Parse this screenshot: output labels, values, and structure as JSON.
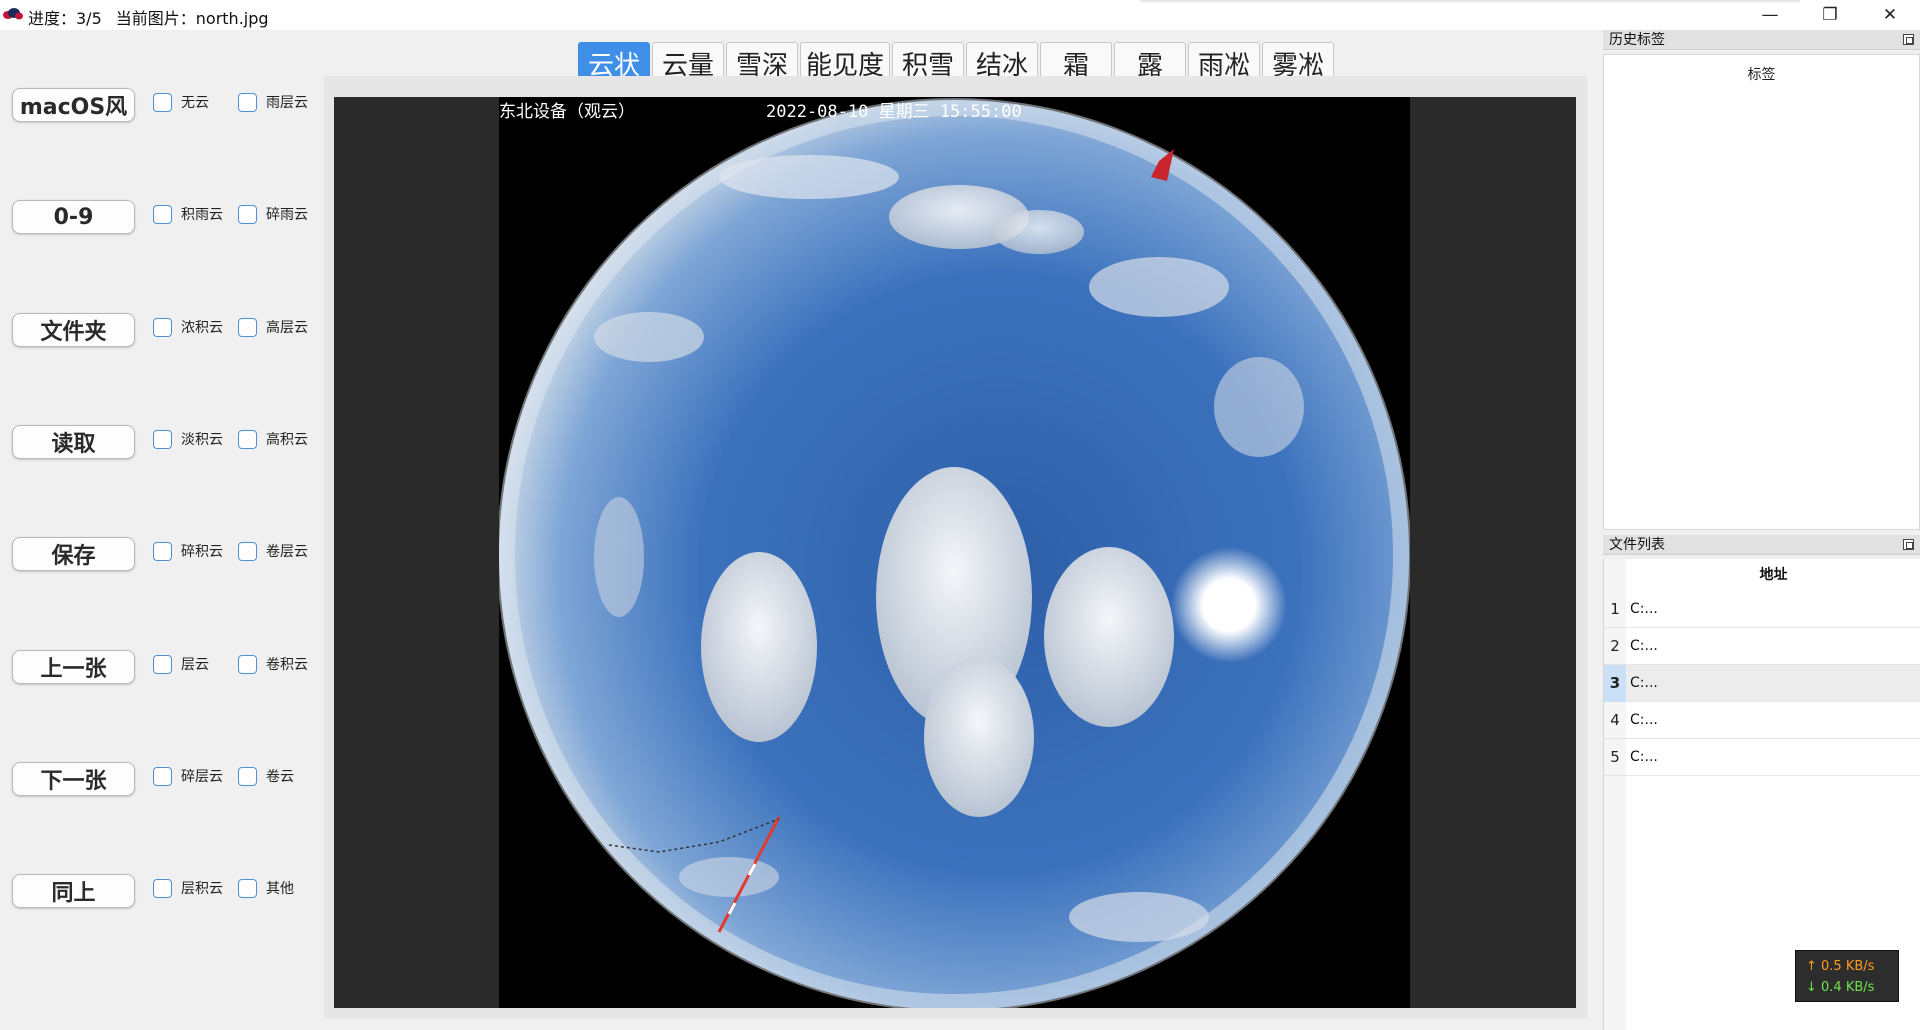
{
  "titlebar": {
    "progress_label": "进度：3/5",
    "current_image_label": "当前图片：north.jpg",
    "minimize_glyph": "—",
    "maximize_glyph": "❐",
    "close_glyph": "✕"
  },
  "sidebar": {
    "rows": [
      {
        "button": "macOS风",
        "check1": "无云",
        "check2": "雨层云"
      },
      {
        "button": "0-9",
        "check1": "积雨云",
        "check2": "碎雨云"
      },
      {
        "button": "文件夹",
        "check1": "浓积云",
        "check2": "高层云"
      },
      {
        "button": "读取",
        "check1": "淡积云",
        "check2": "高积云"
      },
      {
        "button": "保存",
        "check1": "碎积云",
        "check2": "卷层云"
      },
      {
        "button": "上一张",
        "check1": "层云",
        "check2": "卷积云"
      },
      {
        "button": "下一张",
        "check1": "碎层云",
        "check2": "卷云"
      },
      {
        "button": "同上",
        "check1": "层积云",
        "check2": "其他"
      }
    ]
  },
  "tabs": [
    "云状",
    "云量",
    "雪深",
    "能见度",
    "积雪",
    "结冰",
    "霜",
    "露",
    "雨凇",
    "雾凇"
  ],
  "active_tab": "云状",
  "image": {
    "device_caption": "东北设备（观云）",
    "timestamp_caption": "2022-08-10 星期三 15:55:00"
  },
  "history_dock": {
    "title": "历史标签",
    "column_header": "标签"
  },
  "files_dock": {
    "title": "文件列表",
    "column_header": "地址",
    "rows": [
      {
        "index": "1",
        "path": "C:..."
      },
      {
        "index": "2",
        "path": "C:..."
      },
      {
        "index": "3",
        "path": "C:..."
      },
      {
        "index": "4",
        "path": "C:..."
      },
      {
        "index": "5",
        "path": "C:..."
      }
    ],
    "selected_index": "3"
  },
  "netspeed": {
    "upload": "↑ 0.5 KB/s",
    "download": "↓ 0.4 KB/s"
  },
  "colors": {
    "accent": "#3f8fe8",
    "checkbox_border": "#4e8fd6",
    "upload": "#ff9e1b",
    "download": "#6fe34a"
  }
}
